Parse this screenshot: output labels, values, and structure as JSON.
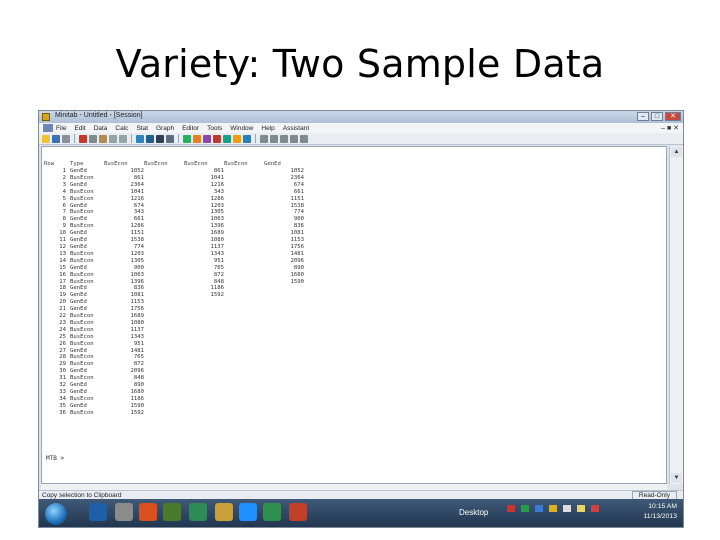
{
  "slide_title": "Variety:  Two Sample Data",
  "window": {
    "title": "Minitab - Untitled - [Session]",
    "controls": [
      "–",
      "□",
      "✕"
    ]
  },
  "menu": [
    "File",
    "Edit",
    "Data",
    "Calc",
    "Stat",
    "Graph",
    "Editor",
    "Tools",
    "Window",
    "Help",
    "Assistant"
  ],
  "menu_right": "– ■ ✕",
  "table": {
    "headers": [
      "Row",
      "Type",
      "BusEcon",
      "BusEcon",
      "BusEcon",
      "BusEcon",
      "GenEd"
    ],
    "rows": [
      [
        "1",
        "GenEd",
        "1052",
        "",
        "861",
        "",
        "1052"
      ],
      [
        "2",
        "BusEcon",
        "861",
        "",
        "1041",
        "",
        "2364"
      ],
      [
        "3",
        "GenEd",
        "2364",
        "",
        "1216",
        "",
        "674"
      ],
      [
        "4",
        "BusEcon",
        "1041",
        "",
        "343",
        "",
        "661"
      ],
      [
        "5",
        "BusEcon",
        "1216",
        "",
        "1286",
        "",
        "1151"
      ],
      [
        "6",
        "GenEd",
        "674",
        "",
        "1203",
        "",
        "1538"
      ],
      [
        "7",
        "BusEcon",
        "343",
        "",
        "1305",
        "",
        "774"
      ],
      [
        "8",
        "GenEd",
        "661",
        "",
        "1063",
        "",
        "900"
      ],
      [
        "9",
        "BusEcon",
        "1286",
        "",
        "1396",
        "",
        "836"
      ],
      [
        "10",
        "GenEd",
        "1151",
        "",
        "1689",
        "",
        "1081"
      ],
      [
        "11",
        "GenEd",
        "1538",
        "",
        "1080",
        "",
        "1153"
      ],
      [
        "12",
        "GenEd",
        "774",
        "",
        "1137",
        "",
        "1756"
      ],
      [
        "13",
        "BusEcon",
        "1203",
        "",
        "1343",
        "",
        "1481"
      ],
      [
        "14",
        "BusEcon",
        "1305",
        "",
        "951",
        "",
        "2096"
      ],
      [
        "15",
        "GenEd",
        "900",
        "",
        "765",
        "",
        "890"
      ],
      [
        "16",
        "BusEcon",
        "1063",
        "",
        "872",
        "",
        "1680"
      ],
      [
        "17",
        "BusEcon",
        "1396",
        "",
        "848",
        "",
        "1590"
      ],
      [
        "18",
        "GenEd",
        "836",
        "",
        "1186",
        "",
        ""
      ],
      [
        "19",
        "GenEd",
        "1081",
        "",
        "1592",
        "",
        ""
      ],
      [
        "20",
        "GenEd",
        "1153",
        "",
        "",
        "",
        ""
      ],
      [
        "21",
        "GenEd",
        "1756",
        "",
        "",
        "",
        ""
      ],
      [
        "22",
        "BusEcon",
        "1689",
        "",
        "",
        "",
        ""
      ],
      [
        "23",
        "BusEcon",
        "1080",
        "",
        "",
        "",
        ""
      ],
      [
        "24",
        "BusEcon",
        "1137",
        "",
        "",
        "",
        ""
      ],
      [
        "25",
        "BusEcon",
        "1343",
        "",
        "",
        "",
        ""
      ],
      [
        "26",
        "BusEcon",
        "951",
        "",
        "",
        "",
        ""
      ],
      [
        "27",
        "GenEd",
        "1481",
        "",
        "",
        "",
        ""
      ],
      [
        "28",
        "BusEcon",
        "765",
        "",
        "",
        "",
        ""
      ],
      [
        "29",
        "BusEcon",
        "872",
        "",
        "",
        "",
        ""
      ],
      [
        "30",
        "GenEd",
        "2096",
        "",
        "",
        "",
        ""
      ],
      [
        "31",
        "BusEcon",
        "848",
        "",
        "",
        "",
        ""
      ],
      [
        "32",
        "GenEd",
        "890",
        "",
        "",
        "",
        ""
      ],
      [
        "33",
        "GenEd",
        "1680",
        "",
        "",
        "",
        ""
      ],
      [
        "34",
        "BusEcon",
        "1186",
        "",
        "",
        "",
        ""
      ],
      [
        "35",
        "GenEd",
        "1590",
        "",
        "",
        "",
        ""
      ],
      [
        "36",
        "BusEcon",
        "1592",
        "",
        "",
        "",
        ""
      ]
    ]
  },
  "prompt": "MTB >",
  "status_text": "Copy selection to Clipboard",
  "status_mode": "Read-Only",
  "taskbar": {
    "desktop_label": "Desktop",
    "time": "10:15 AM",
    "date": "11/13/2013"
  }
}
